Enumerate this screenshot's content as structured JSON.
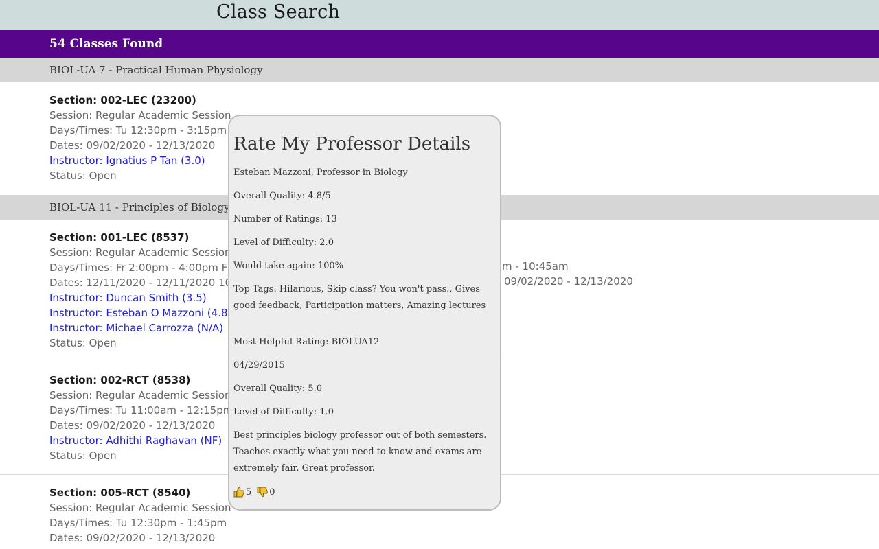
{
  "header": {
    "title": "Class Search"
  },
  "results": {
    "found_label": "54 Classes Found"
  },
  "courses": [
    {
      "title": "BIOL-UA 7 - Practical Human Physiology",
      "sections": [
        {
          "section": "Section: 002-LEC (23200)",
          "session": "Session: Regular Academic Session",
          "days": "Days/Times: Tu 12:30pm - 3:15pm",
          "dates": "Dates: 09/02/2020 - 12/13/2020",
          "instructors": [
            "Instructor: Ignatius P Tan (3.0)"
          ],
          "status": "Status: Open"
        }
      ]
    },
    {
      "title": "BIOL-UA 11 - Principles of Biology I",
      "sections": [
        {
          "section": "Section: 001-LEC (8537)",
          "session": "Session: Regular Academic Session",
          "days": "Days/Times: Fr 2:00pm - 4:00pm F",
          "days_extra": "m - 10:45am",
          "dates": "Dates: 12/11/2020 - 12/11/2020 10",
          "dates_extra": "09/02/2020 - 12/13/2020",
          "instructors": [
            "Instructor: Duncan Smith (3.5)",
            "Instructor: Esteban O Mazzoni (4.8)",
            "Instructor: Michael Carrozza (N/A)"
          ],
          "status": "Status: Open"
        },
        {
          "section": "Section: 002-RCT (8538)",
          "session": "Session: Regular Academic Session",
          "days": "Days/Times: Tu 11:00am - 12:15pm",
          "dates": "Dates: 09/02/2020 - 12/13/2020",
          "instructors": [
            "Instructor: Adhithi Raghavan (NF)"
          ],
          "status": "Status: Open"
        },
        {
          "section": "Section: 005-RCT (8540)",
          "session": "Session: Regular Academic Session",
          "days": "Days/Times: Tu 12:30pm - 1:45pm",
          "dates": "Dates: 09/02/2020 - 12/13/2020"
        }
      ]
    }
  ],
  "popup": {
    "title": "Rate My Professor Details",
    "professor": "Esteban Mazzoni, Professor in Biology",
    "overall_quality": "Overall Quality: 4.8/5",
    "num_ratings": "Number of Ratings: 13",
    "difficulty": "Level of Difficulty: 2.0",
    "take_again": "Would take again: 100%",
    "top_tags": "Top Tags: Hilarious, Skip class? You won't pass., Gives good feedback, Participation matters, Amazing lectures",
    "helpful_label": "Most Helpful Rating: BIOLUA12",
    "helpful_date": "04/29/2015",
    "helpful_quality": "Overall Quality: 5.0",
    "helpful_difficulty": "Level of Difficulty: 1.0",
    "helpful_comment": "Best principles biology professor out of both semesters. Teaches exactly what you need to know and exams are extremely fair. Great professor.",
    "thumbs_up": "5",
    "thumbs_down": "0"
  },
  "colors": {
    "brand": "#57068c",
    "link": "#2222cc",
    "topbar": "#cfdcdc"
  }
}
